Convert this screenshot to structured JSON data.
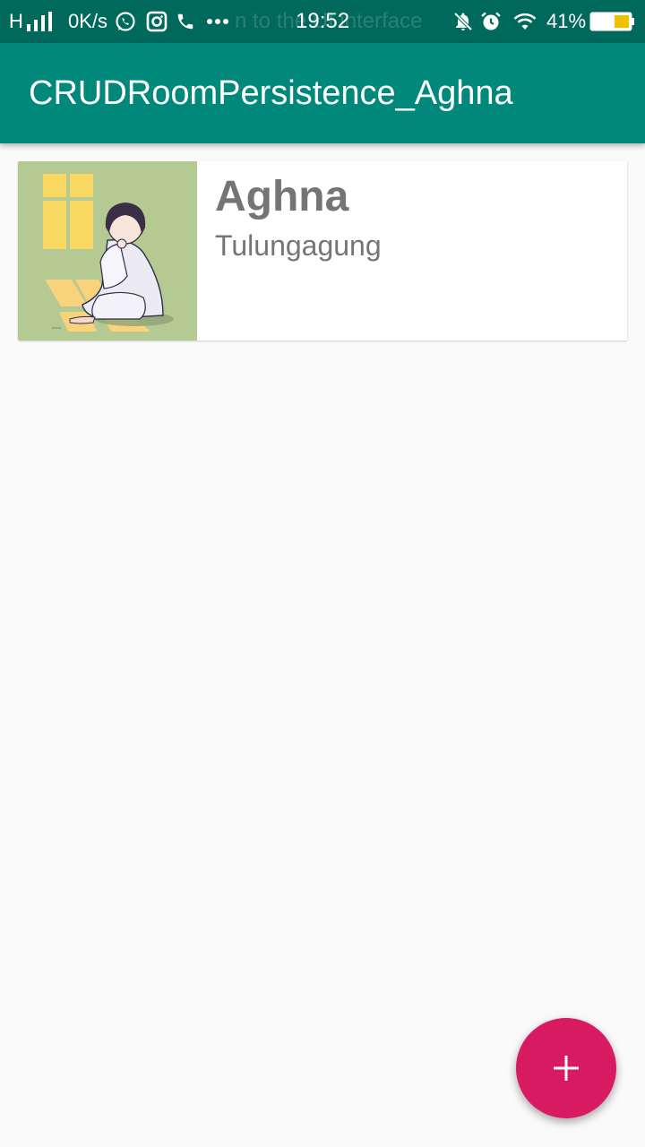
{
  "status_bar": {
    "network_type": "H",
    "speed": "0K/s",
    "time": "19:52",
    "battery_percent": "41%",
    "battery_level": 0.41,
    "ghost_notification": "n to the UI interface",
    "icons": [
      "signal-icon",
      "whatsapp-icon",
      "instagram-icon",
      "phone-icon",
      "more-icon",
      "mute-icon",
      "alarm-icon",
      "wifi-icon",
      "battery-icon"
    ]
  },
  "app_bar": {
    "title": "CRUDRoomPersistence_Aghna"
  },
  "list": {
    "items": [
      {
        "name": "Aghna",
        "city": "Tulungagung",
        "image": "illustration-photo"
      }
    ]
  },
  "fab": {
    "icon": "add-icon"
  },
  "colors": {
    "status_bar": "#00695c",
    "app_bar": "#00897b",
    "accent": "#d81b60",
    "background": "#fafafa",
    "text_secondary": "#757575"
  }
}
